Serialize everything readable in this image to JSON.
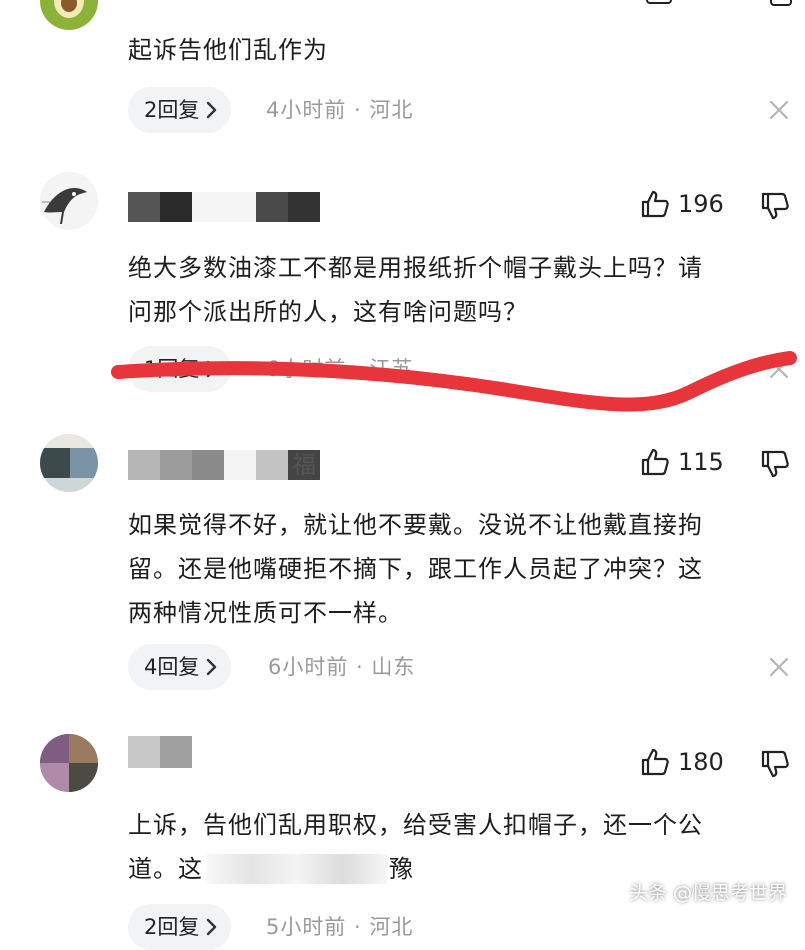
{
  "comments": [
    {
      "text_lines": [
        "起诉告他们乱作为"
      ],
      "reply_label": "2回复",
      "time": "4小时前 · 河北"
    },
    {
      "likes": "196",
      "text_lines": [
        "绝大多数油漆工不都是用报纸折个帽子戴头上吗？请",
        "问那个派出所的人，这有啥问题吗？"
      ],
      "reply_label": "1回复",
      "time": "6小时前 · 江苏"
    },
    {
      "name_visible_char": "福",
      "likes": "115",
      "text_lines": [
        "如果觉得不好，就让他不要戴。没说不让他戴直接拘",
        "留。还是他嘴硬拒不摘下，跟工作人员起了冲突？这",
        "两种情况性质可不一样。"
      ],
      "reply_label": "4回复",
      "time": "6小时前 · 山东"
    },
    {
      "likes": "180",
      "text_lines": [
        "上诉，告他们乱用职权，给受害人扣帽子，还一个公",
        "道。这"
      ],
      "partial_char": "豫",
      "reply_label": "2回复",
      "time": "5小时前 · 河北"
    }
  ],
  "watermark": "头条 @慢思考世界",
  "colors": {
    "pill_bg": "#f2f3f5",
    "meta": "#9a9a9a",
    "annotation": "#e8343b"
  }
}
